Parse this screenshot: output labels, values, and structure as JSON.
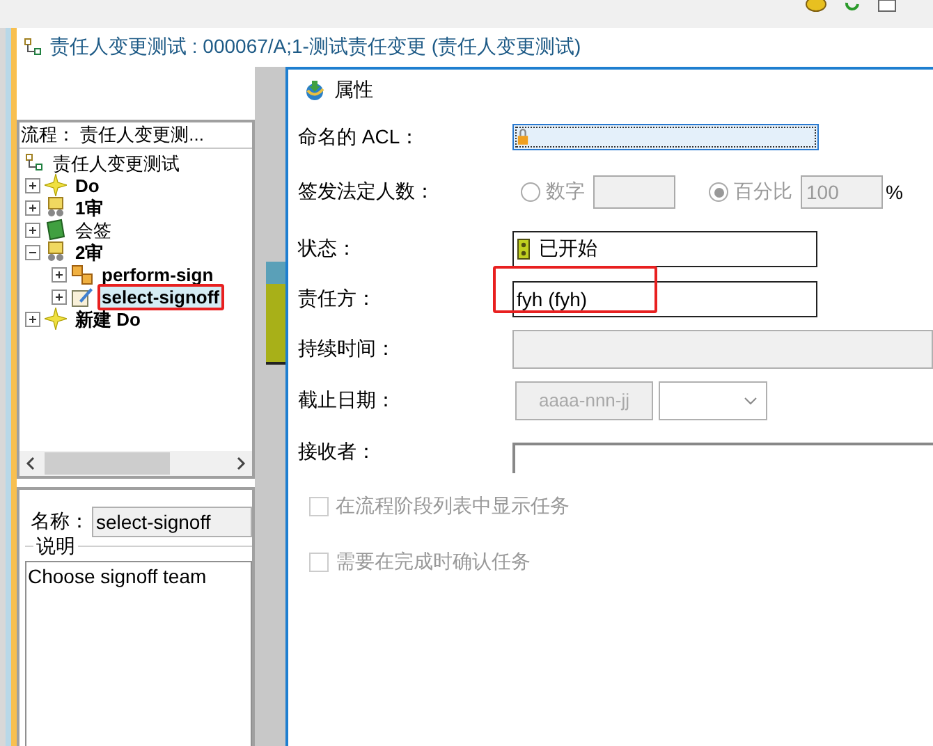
{
  "title": "责任人变更测试 : 000067/A;1-测试责任变更 (责任人变更测试)",
  "process": {
    "header": "流程：  责任人变更测...",
    "root": "责任人变更测试",
    "items": [
      {
        "label": "Do",
        "kind": "task",
        "bold": true,
        "expanded": false,
        "selected": false,
        "highlighted": false
      },
      {
        "label": "1审",
        "kind": "review",
        "bold": true,
        "expanded": false,
        "selected": false,
        "highlighted": false
      },
      {
        "label": "会签",
        "kind": "signoff",
        "bold": false,
        "expanded": false,
        "selected": false,
        "highlighted": false
      },
      {
        "label": "2审",
        "kind": "review",
        "bold": true,
        "expanded": true,
        "selected": false,
        "highlighted": false,
        "children": [
          {
            "label": "perform-sign",
            "kind": "perform",
            "bold": true,
            "expanded": false,
            "selected": false,
            "highlighted": false
          },
          {
            "label": "select-signoff",
            "kind": "select",
            "bold": true,
            "expanded": false,
            "selected": true,
            "highlighted": true
          }
        ]
      },
      {
        "label": "新建 Do",
        "kind": "task",
        "bold": true,
        "expanded": false,
        "selected": false,
        "highlighted": false
      }
    ]
  },
  "name": {
    "label": "名称：",
    "value": "select-signoff"
  },
  "description": {
    "legend": "说明",
    "value": "Choose signoff team"
  },
  "properties": {
    "title": "属性",
    "rows": [
      {
        "kind": "acl",
        "label": "命名的 ACL："
      },
      {
        "kind": "quorum",
        "label": "签发法定人数：",
        "disabled": true,
        "unit": "%",
        "options": [
          {
            "label": "数字",
            "selected": false
          },
          {
            "label": "百分比",
            "selected": true,
            "value": "100"
          }
        ]
      },
      {
        "kind": "status",
        "label": "状态：",
        "value": "已开始"
      },
      {
        "kind": "responsible",
        "label": "责任方：",
        "value": "fyh (fyh)",
        "highlighted": true
      },
      {
        "kind": "duration",
        "label": "持续时间：",
        "disabled": true
      },
      {
        "kind": "due_date",
        "label": "截止日期：",
        "placeholder": "aaaa-nnn-jj",
        "disabled": true
      },
      {
        "kind": "recipient",
        "label": "接收者："
      }
    ],
    "checkboxes": [
      {
        "label": "在流程阶段列表中显示任务",
        "checked": false,
        "disabled": true
      },
      {
        "label": "需要在完成时确认任务",
        "checked": false,
        "disabled": true
      }
    ]
  }
}
